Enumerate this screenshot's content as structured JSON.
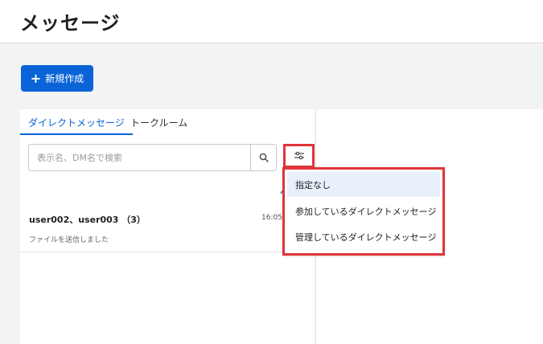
{
  "header": {
    "title": "メッセージ"
  },
  "toolbar": {
    "new_button_label": "新規作成"
  },
  "tabs": [
    {
      "label": "ダイレクトメッセージ",
      "active": true
    },
    {
      "label": "トークルーム",
      "active": false
    }
  ],
  "search": {
    "placeholder": "表示名、DM名で検索",
    "value": ""
  },
  "messages": [
    {
      "title": "user002、user003 （3）",
      "time": "16:05",
      "preview": "ファイルを送信しました"
    }
  ],
  "filter_menu": {
    "items": [
      {
        "label": "指定なし",
        "selected": true
      },
      {
        "label": "参加しているダイレクトメッセージ",
        "selected": false
      },
      {
        "label": "管理しているダイレクトメッセージ",
        "selected": false
      }
    ]
  },
  "colors": {
    "accent": "#0a64d8",
    "highlight_border": "#e0353b",
    "selected_bg": "#e8f1fb"
  },
  "icons": {
    "search": "search-icon",
    "filter": "filter-sliders-icon",
    "plus": "plus-icon",
    "refresh": "refresh-icon"
  }
}
